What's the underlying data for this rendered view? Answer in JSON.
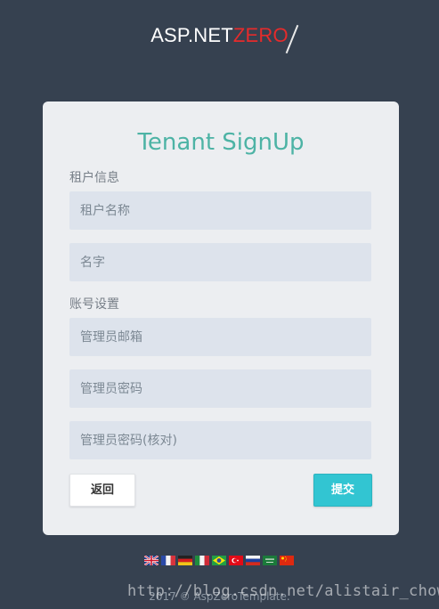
{
  "logo": {
    "prefix": "ASP.NET",
    "suffix": "ZERO",
    "accent_color": "#e52b2b"
  },
  "form": {
    "title": "Tenant SignUp",
    "tenant_section_label": "租户信息",
    "tenant_name_placeholder": "租户名称",
    "name_placeholder": "名字",
    "account_section_label": "账号设置",
    "admin_email_placeholder": "管理员邮箱",
    "admin_password_placeholder": "管理员密码",
    "admin_password_confirm_placeholder": "管理员密码(核对)",
    "back_label": "返回",
    "submit_label": "提交",
    "title_color": "#4db3a5",
    "submit_color": "#32c5d2"
  },
  "languages": [
    {
      "icon": "uk-flag-icon"
    },
    {
      "icon": "france-flag-icon"
    },
    {
      "icon": "germany-flag-icon"
    },
    {
      "icon": "italy-flag-icon"
    },
    {
      "icon": "brazil-flag-icon"
    },
    {
      "icon": "turkey-flag-icon"
    },
    {
      "icon": "russia-flag-icon"
    },
    {
      "icon": "saudi-arabia-flag-icon"
    },
    {
      "icon": "china-flag-icon"
    }
  ],
  "footer": {
    "copyright": "2017 © AspZeroTemplate."
  },
  "watermark": "http://blog.csdn.net/alistair_chow"
}
